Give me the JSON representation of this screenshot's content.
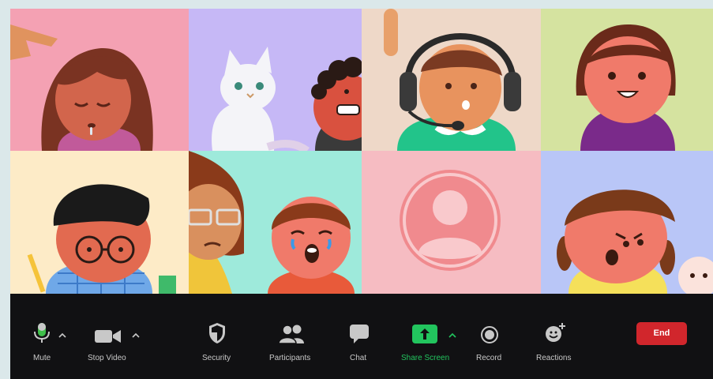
{
  "toolbar": {
    "mute_label": "Mute",
    "stop_video_label": "Stop Video",
    "security_label": "Security",
    "participants_label": "Participants",
    "chat_label": "Chat",
    "share_screen_label": "Share Screen",
    "record_label": "Record",
    "reactions_label": "Reactions",
    "end_label": "End"
  },
  "icons": {
    "mute": "microphone-icon",
    "stop_video": "video-camera-icon",
    "security": "shield-icon",
    "participants": "people-icon",
    "chat": "chat-bubble-icon",
    "share_screen": "share-arrow-icon",
    "record": "record-icon",
    "reactions": "smiley-plus-icon"
  },
  "colors": {
    "share_screen_green": "#22c55e",
    "end_red": "#d1262c",
    "toolbar_bg": "#111113",
    "window_bg": "#dbe8ea"
  },
  "participants": [
    {
      "tile": 1,
      "background": "#f4a1b3"
    },
    {
      "tile": 2,
      "background": "#c6b8f6"
    },
    {
      "tile": 3,
      "background": "#eed8c8"
    },
    {
      "tile": 4,
      "background": "#d5e3a0"
    },
    {
      "tile": 5,
      "background": "#fdebc7"
    },
    {
      "tile": 6,
      "background": "#9eeadb"
    },
    {
      "tile": 7,
      "background": "#f6bcc2"
    },
    {
      "tile": 8,
      "background": "#b9c6f7"
    }
  ]
}
